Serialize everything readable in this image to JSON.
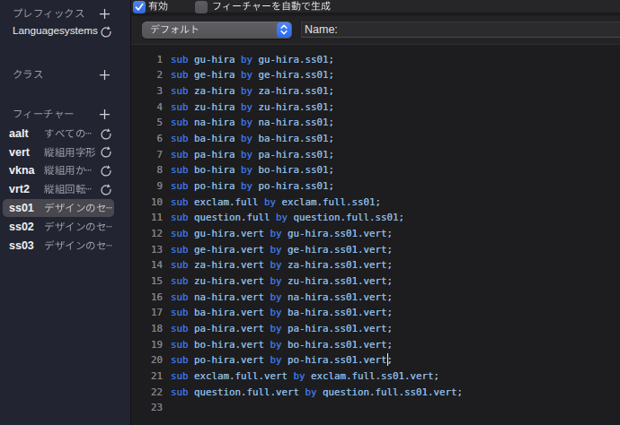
{
  "colors": {
    "accent_blue": "#3b77e8",
    "keyword_blue": "#3E74E0",
    "glyph_name_blue": "#8AB9E3",
    "sidebar_bg": "#222431",
    "editor_bg": "#1d1d1f",
    "selection_gray": "#47474d"
  },
  "sidebar": {
    "prefix_section": {
      "label": "プレフィックス"
    },
    "class_section": {
      "label": "クラス"
    },
    "feature_section": {
      "label": "フィーチャー"
    },
    "prefix_items": [
      {
        "name": "Languagesystems"
      }
    ],
    "features": [
      {
        "tag": "aalt",
        "description": "すべての…",
        "auto": true,
        "selected": false
      },
      {
        "tag": "vert",
        "description": "縦組用字形",
        "auto": true,
        "selected": false
      },
      {
        "tag": "vkna",
        "description": "縦組用か…",
        "auto": true,
        "selected": false
      },
      {
        "tag": "vrt2",
        "description": "縦組回転…",
        "auto": true,
        "selected": false
      },
      {
        "tag": "ss01",
        "description": "デザインのセ…",
        "auto": false,
        "selected": true
      },
      {
        "tag": "ss02",
        "description": "デザインのセ…",
        "auto": false,
        "selected": false
      },
      {
        "tag": "ss03",
        "description": "デザインのセ…",
        "auto": false,
        "selected": false
      }
    ]
  },
  "toolbar": {
    "enabled_checkbox": {
      "label": "有効",
      "checked": true
    },
    "auto_generate_checkbox": {
      "label": "フィーチャーを自動で生成",
      "checked": false
    },
    "language_popup": {
      "value": "デフォルト"
    },
    "name_field": {
      "label": "Name:",
      "value": ""
    }
  },
  "editor": {
    "keywords": [
      "sub",
      "by"
    ],
    "caret": {
      "line": 20,
      "column": 37
    },
    "lines": [
      "sub gu-hira by gu-hira.ss01;",
      "sub ge-hira by ge-hira.ss01;",
      "sub za-hira by za-hira.ss01;",
      "sub zu-hira by zu-hira.ss01;",
      "sub na-hira by na-hira.ss01;",
      "sub ba-hira by ba-hira.ss01;",
      "sub pa-hira by pa-hira.ss01;",
      "sub bo-hira by bo-hira.ss01;",
      "sub po-hira by po-hira.ss01;",
      "sub exclam.full by exclam.full.ss01;",
      "sub question.full by question.full.ss01;",
      "sub gu-hira.vert by gu-hira.ss01.vert;",
      "sub ge-hira.vert by ge-hira.ss01.vert;",
      "sub za-hira.vert by za-hira.ss01.vert;",
      "sub zu-hira.vert by zu-hira.ss01.vert;",
      "sub na-hira.vert by na-hira.ss01.vert;",
      "sub ba-hira.vert by ba-hira.ss01.vert;",
      "sub pa-hira.vert by pa-hira.ss01.vert;",
      "sub bo-hira.vert by bo-hira.ss01.vert;",
      "sub po-hira.vert by po-hira.ss01.vert;",
      "sub exclam.full.vert by exclam.full.ss01.vert;",
      "sub question.full.vert by question.full.ss01.vert;",
      ""
    ]
  }
}
